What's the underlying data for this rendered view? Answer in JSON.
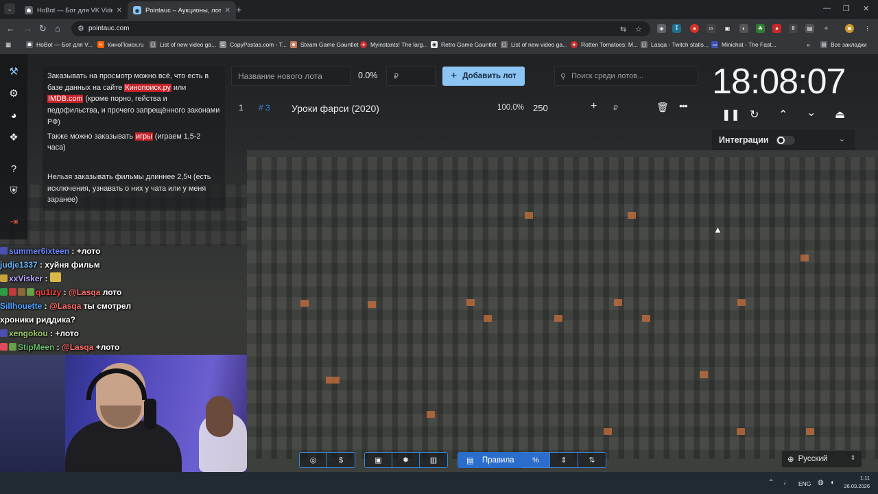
{
  "browser": {
    "tabs": [
      {
        "title": "HoBot — Бот для VK Video Live",
        "active": false
      },
      {
        "title": "Pointauc – Аукционы, лотереи",
        "active": true
      }
    ],
    "url": "pointauc.com",
    "bookmarks": [
      "HoBot — Бот для V...",
      "КиноПоиск.ru",
      "List of new video ga...",
      "CopyPastas.com - T...",
      "Steam Game Gauntlet",
      "Myinstants! The larg...",
      "Retro Game Gauntlet",
      "List of new video ga...",
      "Rotten Tomatoes: M...",
      "Lasqa - Twitch statis...",
      "Minichat - The Fast..."
    ],
    "all_bookmarks": "Все закладки"
  },
  "rules": {
    "p1_a": "Заказывать на просмотр можно всё, что есть в базе данных на сайте ",
    "p1_link1": "Кинопоиск.ру",
    "p1_b": " или ",
    "p1_link2": "IMDB.com",
    "p1_c": " (кроме порно, гейства и педофильства, и прочего запрещённого законами РФ)",
    "p2_a": "Также можно заказывать ",
    "p2_link": "игры",
    "p2_b": " (играем 1,5-2 часа)",
    "p3": "Нельзя заказывать фильмы длиннее 2,5ч (есть исключения, узнавать о них у чата или у меня заранее)"
  },
  "new_lot": {
    "name_placeholder": "Название нового лота",
    "percent": "0.0%",
    "amount_placeholder": "₽",
    "add_label": "Добавить лот",
    "search_placeholder": "Поиск среди лотов..."
  },
  "lots": [
    {
      "index": "1",
      "id": "# 3",
      "name": "Уроки фарси (2020)",
      "percent": "100.0%",
      "amount": "250",
      "currency": "₽"
    }
  ],
  "timer": {
    "time": "18:08:07",
    "integrations_label": "Интеграции"
  },
  "chat": [
    {
      "user": "summer6ixteen",
      "msg": "+лото",
      "color": "#6b86ff",
      "badges": [
        "#4b4fb0"
      ]
    },
    {
      "user": "judje1337",
      "msg": "хуйня фильм",
      "color": "#64b5f6",
      "badges": []
    },
    {
      "user": "xxVisker",
      "msg": "",
      "color": "#b9a6ff",
      "badges": [
        "#c9a43a"
      ]
    },
    {
      "user": "qu1izy",
      "mention": "@Lasqa",
      "msg": "лото",
      "color": "#ff3a3a",
      "badges": [
        "#2e9e44",
        "#c0393b",
        "#8a6a3a",
        "#6aa04a"
      ]
    },
    {
      "user": "Sillhouette",
      "mention": "@Lasqa",
      "msg": "ты смотрел",
      "color": "#4aa3ff",
      "badges": []
    },
    {
      "user": "",
      "msg": "хроники риддика?",
      "color": "#ffffff",
      "badges": []
    },
    {
      "user": "xengokou",
      "msg": "+лото",
      "color": "#9ccc65",
      "badges": [
        "#4b4fb0"
      ]
    },
    {
      "user": "StipMeen",
      "mention": "@Lasqa",
      "msg": "+лото",
      "color": "#66bb6a",
      "badges": [
        "#e04a5a",
        "#6aa04a"
      ]
    }
  ],
  "bottom": {
    "rules_label": "Правила",
    "language": "Русский"
  },
  "taskbar": {
    "lang": "ENG",
    "time": "1:11",
    "date": "26.03.2026"
  },
  "colors": {
    "accent": "#8cc4f4",
    "primary_blue": "#2a6dcc",
    "link_highlight": "#c7222a",
    "lot_id": "#3b82d4"
  }
}
